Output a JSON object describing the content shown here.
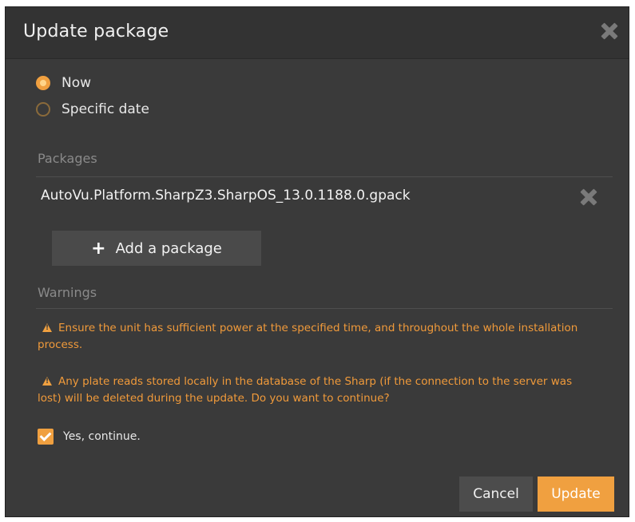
{
  "dialog": {
    "title": "Update package"
  },
  "schedule": {
    "options": [
      {
        "label": "Now",
        "selected": true
      },
      {
        "label": "Specific date",
        "selected": false
      }
    ]
  },
  "packages": {
    "header": "Packages",
    "items": [
      "AutoVu.Platform.SharpZ3.SharpOS_13.0.1188.0.gpack"
    ],
    "add_label": "Add a package"
  },
  "warnings": {
    "header": "Warnings",
    "items": [
      "Ensure the unit has sufficient power at the specified time, and throughout the whole installation process.",
      "Any plate reads stored locally in the database of the Sharp (if the connection to the server was lost) will be deleted during the update. Do you want to continue?"
    ]
  },
  "confirm": {
    "label": "Yes, continue.",
    "checked": true
  },
  "footer": {
    "cancel_label": "Cancel",
    "update_label": "Update"
  },
  "colors": {
    "accent": "#f0a040",
    "background": "#3a3a3a",
    "warning_text": "#f09a3a"
  },
  "icons": [
    "close-icon",
    "remove-package-icon",
    "plus-icon",
    "warning-icon",
    "checkmark-icon"
  ]
}
